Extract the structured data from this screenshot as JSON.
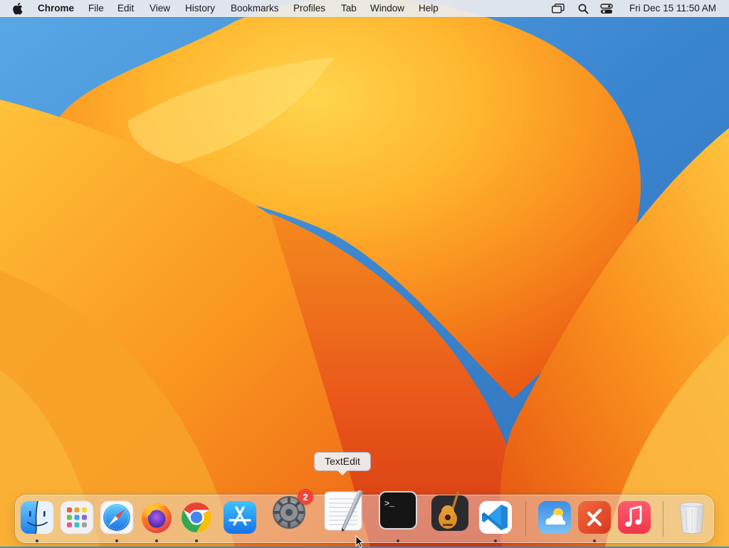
{
  "menubar": {
    "app_name": "Chrome",
    "items": [
      "File",
      "Edit",
      "View",
      "History",
      "Bookmarks",
      "Profiles",
      "Tab",
      "Window",
      "Help"
    ],
    "status_icons": [
      "screen-mirroring-icon",
      "spotlight-search-icon",
      "control-center-icon"
    ],
    "clock": "Fri Dec 15  11:50 AM"
  },
  "dock": {
    "apps": [
      {
        "name": "Finder",
        "icon": "finder-icon",
        "running": true
      },
      {
        "name": "Launchpad",
        "icon": "launchpad-icon",
        "running": false
      },
      {
        "name": "Safari",
        "icon": "safari-icon",
        "running": true
      },
      {
        "name": "Firefox",
        "icon": "firefox-icon",
        "running": true
      },
      {
        "name": "Google Chrome",
        "icon": "chrome-icon",
        "running": true
      },
      {
        "name": "App Store",
        "icon": "app-store-icon",
        "running": false
      },
      {
        "name": "System Settings",
        "icon": "system-settings-icon",
        "running": false,
        "badge": "2"
      },
      {
        "name": "TextEdit",
        "icon": "textedit-icon",
        "running": false
      },
      {
        "name": "Terminal",
        "icon": "terminal-icon",
        "running": true
      },
      {
        "name": "GarageBand",
        "icon": "garageband-icon",
        "running": false
      },
      {
        "name": "Visual Studio Code",
        "icon": "vscode-icon",
        "running": true
      },
      {
        "name": "Weather",
        "icon": "weather-icon",
        "running": false
      },
      {
        "name": "Remote Desktop",
        "icon": "remote-desktop-icon",
        "running": true
      },
      {
        "name": "Music",
        "icon": "music-icon",
        "running": false
      },
      {
        "name": "Trash",
        "icon": "trash-icon",
        "running": false
      }
    ],
    "tooltip": "TextEdit"
  },
  "colors": {
    "wallpaper_blue": "#3f8fd6",
    "wallpaper_orange": "#f7941d",
    "wallpaper_yellow": "#ffd04a",
    "badge_red": "#f0443a"
  }
}
